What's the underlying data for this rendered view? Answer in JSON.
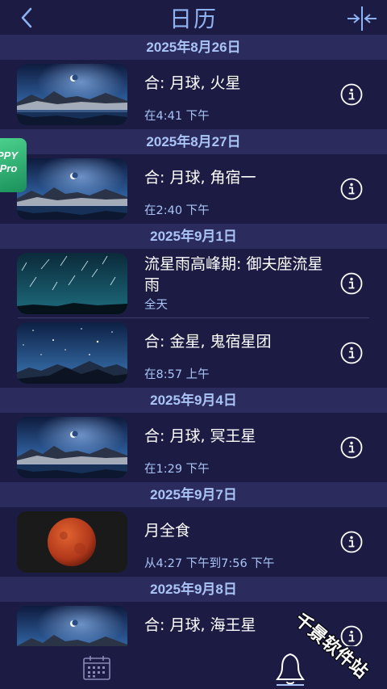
{
  "header": {
    "title": "日历",
    "back_icon": "chevron-left-icon",
    "compress_icon": "collapse-arrows-icon"
  },
  "groups": [
    {
      "date": "2025年8月26日",
      "events": [
        {
          "title": "合: 月球, 火星",
          "time": "在4:41 下午",
          "image": "moon-lake-night"
        }
      ]
    },
    {
      "date": "2025年8月27日",
      "events": [
        {
          "title": "合: 月球, 角宿一",
          "time": "在2:40 下午",
          "image": "moon-lake-night"
        }
      ]
    },
    {
      "date": "2025年9月1日",
      "events": [
        {
          "title": "流星雨高峰期: 御夫座流星雨",
          "time": "全天",
          "image": "meteor-shower"
        },
        {
          "title": "合: 金星, 鬼宿星团",
          "time": "在8:57 上午",
          "image": "starry-mountains"
        }
      ]
    },
    {
      "date": "2025年9月4日",
      "events": [
        {
          "title": "合: 月球, 冥王星",
          "time": "在1:29 下午",
          "image": "moon-lake-night"
        }
      ]
    },
    {
      "date": "2025年9月7日",
      "events": [
        {
          "title": "月全食",
          "time": "从4:27 下午到7:56 下午",
          "image": "blood-moon"
        }
      ]
    },
    {
      "date": "2025年9月8日",
      "events": [
        {
          "title": "合: 月球, 海王星",
          "time": "",
          "image": "moon-lake-night"
        }
      ]
    }
  ],
  "side_badge": {
    "line1": "PPY",
    "line2": "IPro"
  },
  "tabbar": {
    "calendar_icon": "calendar-icon",
    "bell_icon": "bell-icon",
    "active": "bell"
  },
  "watermark": "千景软件站",
  "colors": {
    "background": "#1b1b44",
    "date_header_bg": "#2b2c5d",
    "accent": "#a9c4f5",
    "title_blue": "#8fb3f2"
  }
}
